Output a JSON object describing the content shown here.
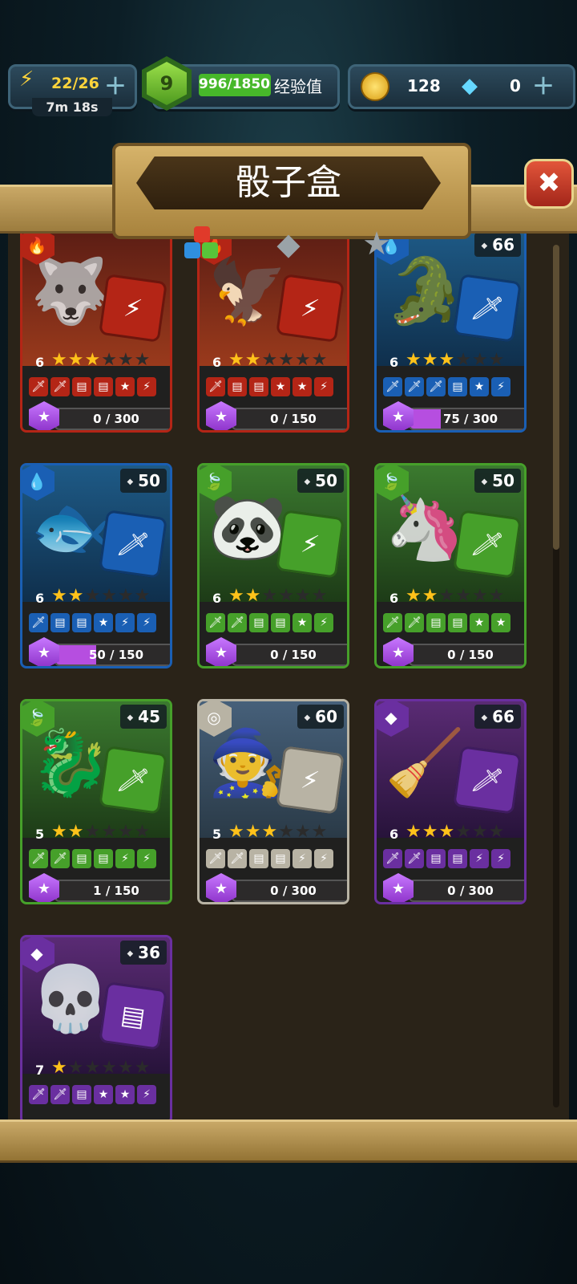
{
  "hud": {
    "energy": "22/26",
    "energy_timer": "7m 18s",
    "level": "9",
    "xp": "996/1850",
    "xp_label": "经验值",
    "coins": "128",
    "gems": "0"
  },
  "title": "骰子盒",
  "colors": {
    "fire": "#b42516",
    "water": "#1a5fb4",
    "plant": "#46a02a",
    "neutral": "#b8b3a4",
    "dark": "#6a2fa0"
  },
  "cards": [
    {
      "gems": "",
      "rank": "6",
      "stars": 3,
      "max_stars": 6,
      "progress": "0 / 300",
      "progress_frac": 0.0,
      "element": "fire",
      "creature": "wolf",
      "die_glyph": "⚡",
      "faces": [
        "🗡",
        "🗡",
        "▤",
        "▤",
        "★",
        "⚡"
      ]
    },
    {
      "gems": "",
      "rank": "6",
      "stars": 2,
      "max_stars": 6,
      "progress": "0 / 150",
      "progress_frac": 0.0,
      "element": "fire",
      "creature": "eagle",
      "die_glyph": "⚡",
      "faces": [
        "🗡",
        "▤",
        "▤",
        "★",
        "★",
        "⚡"
      ]
    },
    {
      "gems": "66",
      "rank": "6",
      "stars": 3,
      "max_stars": 6,
      "progress": "75 / 300",
      "progress_frac": 0.25,
      "element": "water",
      "creature": "crocodile",
      "die_glyph": "🗡",
      "faces": [
        "🗡",
        "🗡",
        "🗡",
        "▤",
        "★",
        "⚡"
      ]
    },
    {
      "gems": "50",
      "rank": "6",
      "stars": 2,
      "max_stars": 6,
      "progress": "50 / 150",
      "progress_frac": 0.333,
      "element": "water",
      "creature": "fish",
      "die_glyph": "🗡",
      "faces": [
        "🗡",
        "▤",
        "▤",
        "★",
        "⚡",
        "⚡"
      ]
    },
    {
      "gems": "50",
      "rank": "6",
      "stars": 2,
      "max_stars": 6,
      "progress": "0 / 150",
      "progress_frac": 0.0,
      "element": "plant",
      "creature": "panda",
      "die_glyph": "⚡",
      "faces": [
        "🗡",
        "🗡",
        "▤",
        "▤",
        "★",
        "⚡"
      ]
    },
    {
      "gems": "50",
      "rank": "6",
      "stars": 2,
      "max_stars": 6,
      "progress": "0 / 150",
      "progress_frac": 0.0,
      "element": "plant",
      "creature": "unicorn",
      "die_glyph": "🗡",
      "faces": [
        "🗡",
        "🗡",
        "▤",
        "▤",
        "★",
        "★"
      ]
    },
    {
      "gems": "45",
      "rank": "5",
      "stars": 2,
      "max_stars": 6,
      "progress": "1 / 150",
      "progress_frac": 0.007,
      "element": "plant",
      "creature": "hydra",
      "die_glyph": "🗡",
      "faces": [
        "🗡",
        "🗡",
        "▤",
        "▤",
        "⚡",
        "⚡"
      ]
    },
    {
      "gems": "60",
      "rank": "5",
      "stars": 3,
      "max_stars": 6,
      "progress": "0 / 300",
      "progress_frac": 0.0,
      "element": "neutral",
      "creature": "wizard",
      "die_glyph": "⚡",
      "faces": [
        "🗡",
        "🗡",
        "▤",
        "▤",
        "⚡",
        "⚡"
      ]
    },
    {
      "gems": "66",
      "rank": "6",
      "stars": 3,
      "max_stars": 6,
      "progress": "0 / 300",
      "progress_frac": 0.0,
      "element": "dark",
      "creature": "witch",
      "die_glyph": "🗡",
      "faces": [
        "🗡",
        "🗡",
        "▤",
        "▤",
        "⚡",
        "⚡"
      ]
    },
    {
      "gems": "36",
      "rank": "7",
      "stars": 1,
      "max_stars": 6,
      "progress": "",
      "progress_frac": 0.0,
      "element": "dark",
      "creature": "skeleton",
      "die_glyph": "▤",
      "faces": [
        "🗡",
        "🗡",
        "▤",
        "★",
        "★",
        "⚡"
      ]
    }
  ]
}
